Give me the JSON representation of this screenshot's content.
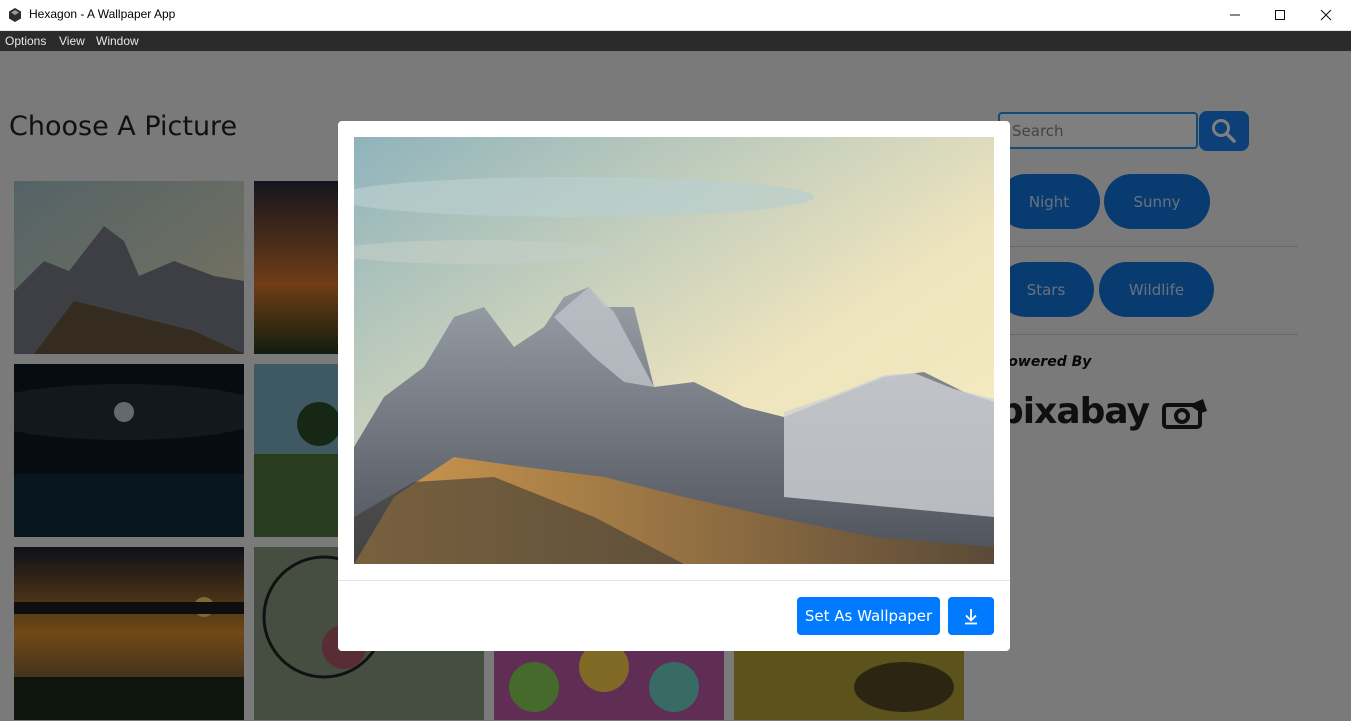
{
  "window": {
    "title": "Hexagon - A Wallpaper App",
    "controls": [
      "minimize",
      "maximize",
      "close"
    ]
  },
  "menu": {
    "items": [
      "Options",
      "View",
      "Window"
    ]
  },
  "main": {
    "heading": "Choose A Picture"
  },
  "search": {
    "placeholder": "Search"
  },
  "categories": [
    "Night",
    "Sunny",
    "Stars",
    "Wildlife"
  ],
  "credits": {
    "powered_by": "Powered By",
    "brand": "pixabay"
  },
  "modal": {
    "set_wallpaper_label": "Set As Wallpaper",
    "download_icon": "download-icon"
  },
  "colors": {
    "accent": "#007bff",
    "category_button": "#1176e0",
    "menubar": "#2b2b2b"
  }
}
